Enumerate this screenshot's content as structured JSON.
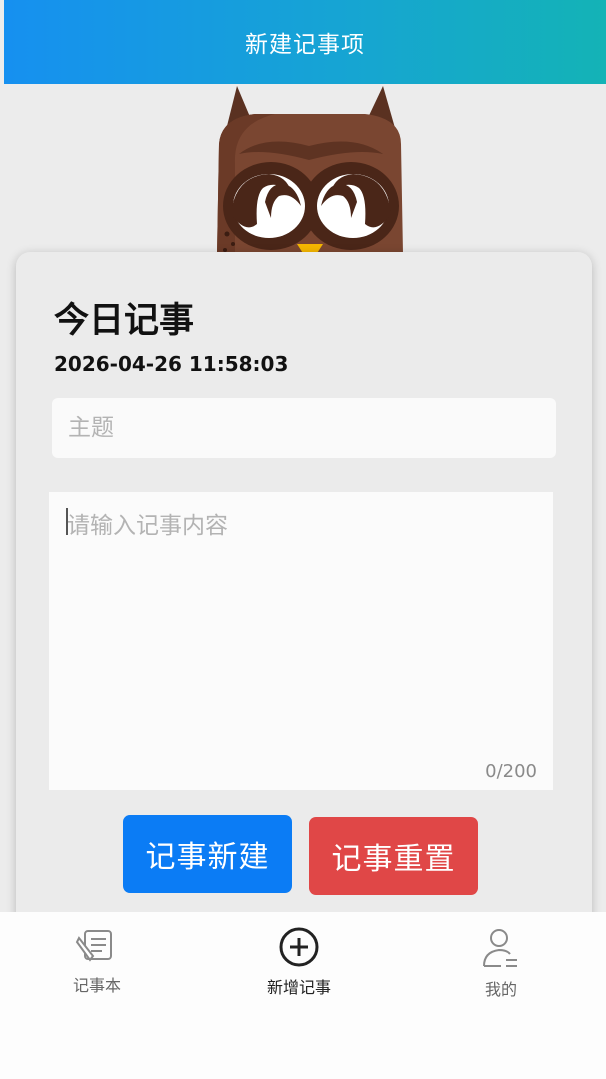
{
  "header": {
    "title": "新建记事项"
  },
  "card": {
    "title": "今日记事",
    "datetime": "2026-04-26 11:58:03",
    "topic_placeholder": "主题",
    "content_placeholder": "请输入记事内容",
    "counter": "0/200",
    "create_button": "记事新建",
    "reset_button": "记事重置"
  },
  "tabs": [
    {
      "label": "记事本",
      "icon": "notebook-icon"
    },
    {
      "label": "新增记事",
      "icon": "add-circle-icon"
    },
    {
      "label": "我的",
      "icon": "user-icon"
    }
  ],
  "colors": {
    "header_gradient_start": "#1690f0",
    "header_gradient_end": "#14b3b6",
    "create_button": "#0b7cf5",
    "reset_button": "#e04747"
  }
}
